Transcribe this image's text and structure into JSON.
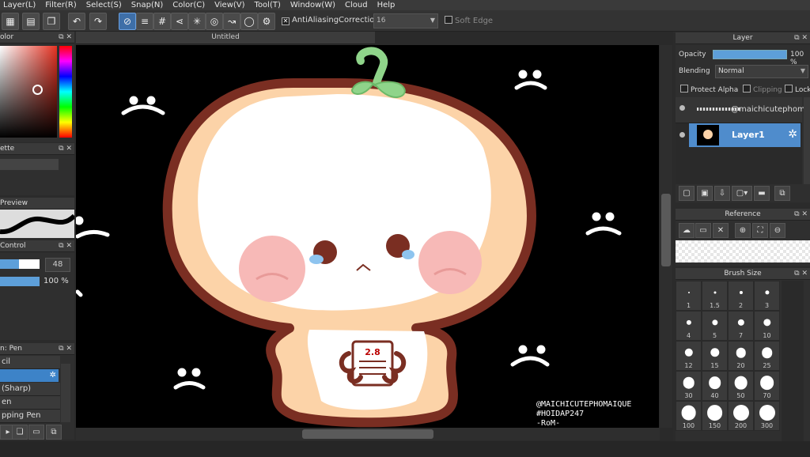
{
  "menu": [
    "Layer(L)",
    "Filter(R)",
    "Select(S)",
    "Snap(N)",
    "Color(C)",
    "View(V)",
    "Tool(T)",
    "Window(W)",
    "Cloud",
    "Help"
  ],
  "toolbar": {
    "antialiasing_label": "AntiAliasing",
    "correction_label": "Correction",
    "correction_value": "16",
    "soft_edge_label": "Soft Edge"
  },
  "left": {
    "color_title": "olor",
    "palette_title": "ette",
    "preview_title": "Preview",
    "control_title": "Control",
    "control_size": "48",
    "control_opacity": "100 %",
    "brush_title": "n: Pen",
    "brush_items": [
      "cil",
      "",
      "(Sharp)",
      "en",
      "pping Pen"
    ]
  },
  "canvas": {
    "tab_title": "Untitled",
    "watermark": [
      "@MAICHICUTEPHOMAIQUE",
      "#HOIDAP247",
      "-RoM-"
    ],
    "note_text": "2.8"
  },
  "layer_panel": {
    "title": "Layer",
    "opacity_label": "Opacity",
    "opacity_value": "100 %",
    "opacity_level": 1.0,
    "blending_label": "Blending",
    "blending_value": "Normal",
    "protect_alpha": "Protect Alpha",
    "clipping": "Clipping",
    "lock": "Lock",
    "layers": [
      {
        "name": "@maichicutephom",
        "selected": false
      },
      {
        "name": "Layer1",
        "selected": true
      }
    ]
  },
  "reference_panel": {
    "title": "Reference"
  },
  "brush_size_panel": {
    "title": "Brush Size",
    "sizes": [
      "1",
      "1.5",
      "2",
      "3",
      "4",
      "5",
      "7",
      "10",
      "12",
      "15",
      "20",
      "25",
      "30",
      "40",
      "50",
      "70",
      "100",
      "150",
      "200",
      "300"
    ]
  },
  "colors": {
    "accent": "#5d9fd9",
    "outline": "#7a2e22",
    "leaf": "#8fd48a",
    "cheek": "#f7b9b7",
    "shade": "#fcd3a8"
  }
}
